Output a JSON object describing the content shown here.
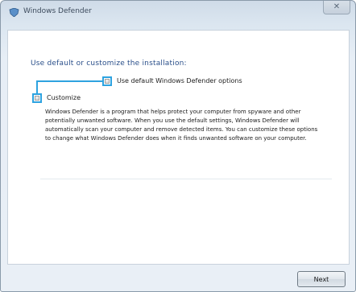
{
  "window": {
    "title": "Windows Defender",
    "close_glyph": "✕"
  },
  "wizard": {
    "instruction": "Use default or customize the installation:",
    "options": [
      {
        "label": "Use default Windows Defender options"
      },
      {
        "label": "Customize"
      }
    ],
    "description": "Windows Defender is a program that helps protect your computer from spyware and other potentially unwanted software. When you use the default settings, Windows Defender will automatically scan your computer and remove detected items. You can customize these options to change what Windows Defender does when it finds unwanted software on your computer."
  },
  "footer": {
    "next_label": "Next"
  },
  "colors": {
    "highlight": "#2ea3e0",
    "instruction_text": "#2a4f8a"
  }
}
